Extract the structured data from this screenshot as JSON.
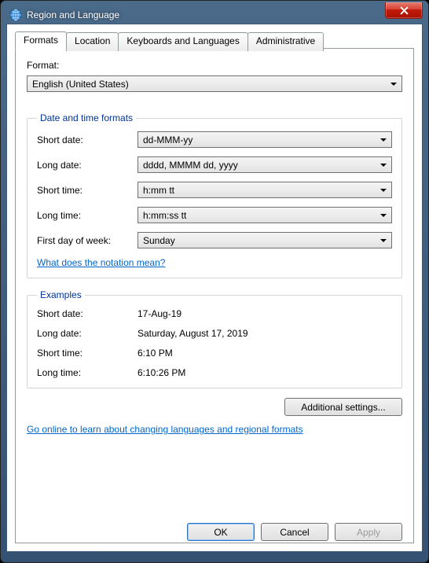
{
  "window": {
    "title": "Region and Language"
  },
  "tabs": {
    "t0": "Formats",
    "t1": "Location",
    "t2": "Keyboards and Languages",
    "t3": "Administrative"
  },
  "format": {
    "label": "Format:",
    "value": "English (United States)"
  },
  "dtGroup": {
    "legend": "Date and time formats",
    "shortDate": {
      "label": "Short date:",
      "value": "dd-MMM-yy"
    },
    "longDate": {
      "label": "Long date:",
      "value": "dddd, MMMM dd, yyyy"
    },
    "shortTime": {
      "label": "Short time:",
      "value": "h:mm tt"
    },
    "longTime": {
      "label": "Long time:",
      "value": "h:mm:ss tt"
    },
    "firstDay": {
      "label": "First day of week:",
      "value": "Sunday"
    },
    "notationLink": "What does the notation mean?"
  },
  "examples": {
    "legend": "Examples",
    "shortDate": {
      "label": "Short date:",
      "value": "17-Aug-19"
    },
    "longDate": {
      "label": "Long date:",
      "value": "Saturday, August 17, 2019"
    },
    "shortTime": {
      "label": "Short time:",
      "value": "6:10 PM"
    },
    "longTime": {
      "label": "Long time:",
      "value": "6:10:26 PM"
    }
  },
  "additionalBtn": "Additional settings...",
  "onlineLink": "Go online to learn about changing languages and regional formats",
  "buttons": {
    "ok": "OK",
    "cancel": "Cancel",
    "apply": "Apply"
  }
}
